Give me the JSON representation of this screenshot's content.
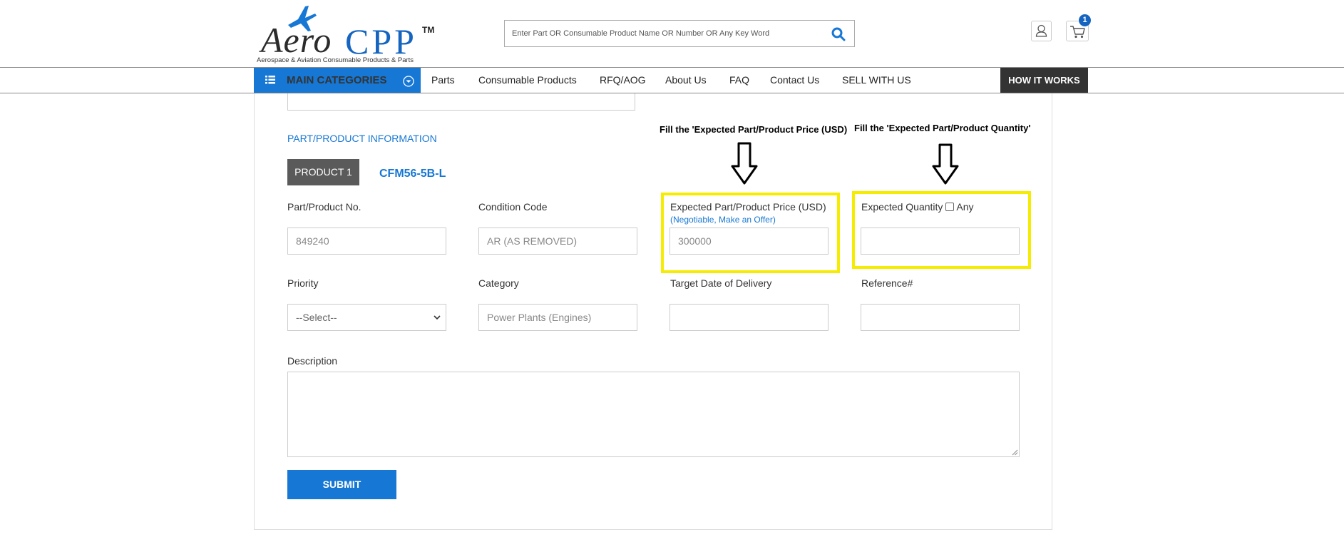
{
  "brand": {
    "name_part1": "Aero",
    "name_part2": "CPP",
    "trademark": "TM",
    "tagline": "Aerospace & Aviation Consumable Products & Parts",
    "accent_color": "#1677d4"
  },
  "search": {
    "placeholder": "Enter Part OR Consumable Product Name OR Number OR Any Key Word",
    "icon": "search-icon"
  },
  "header_icons": {
    "user": "user-icon",
    "cart": "cart-icon",
    "cart_count": "1"
  },
  "nav": {
    "main_categories": "MAIN CATEGORIES",
    "items": [
      "Parts",
      "Consumable Products",
      "RFQ/AOG",
      "About Us",
      "FAQ",
      "Contact Us",
      "SELL WITH US"
    ],
    "how_it_works": "HOW IT WORKS"
  },
  "form": {
    "section_title": "PART/PRODUCT INFORMATION",
    "product_tab": "PRODUCT 1",
    "product_name": "CFM56-5B-L",
    "fields": {
      "part_no": {
        "label": "Part/Product No.",
        "value": "849240"
      },
      "condition": {
        "label": "Condition Code",
        "value": "AR (AS REMOVED)"
      },
      "price": {
        "label": "Expected Part/Product Price (USD)",
        "note": "(Negotiable, Make an Offer)",
        "value": "300000"
      },
      "quantity": {
        "label": "Expected Quantity",
        "checkbox_label": "Any",
        "value": ""
      },
      "priority": {
        "label": "Priority",
        "value": "--Select--"
      },
      "category": {
        "label": "Category",
        "value": "Power Plants (Engines)"
      },
      "target_date": {
        "label": "Target Date of Delivery",
        "value": ""
      },
      "reference": {
        "label": "Reference#",
        "value": ""
      },
      "description": {
        "label": "Description",
        "value": ""
      }
    },
    "submit": "SUBMIT"
  },
  "annotations": {
    "price_hint": "Fill the 'Expected Part/Product Price (USD)",
    "quantity_hint": "Fill the 'Expected Part/Product Quantity'",
    "highlight_color": "#f5ec00"
  }
}
